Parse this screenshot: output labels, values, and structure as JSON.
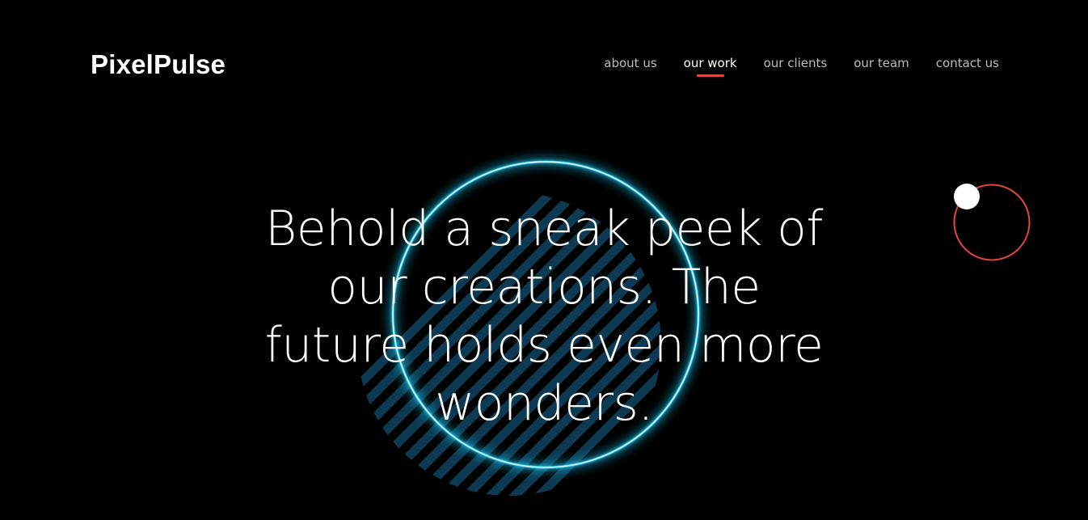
{
  "brand": {
    "name": "PixelPulse"
  },
  "nav": {
    "items": [
      {
        "label": "about us",
        "active": false
      },
      {
        "label": "our work",
        "active": true
      },
      {
        "label": "our clients",
        "active": false
      },
      {
        "label": "our team",
        "active": false
      },
      {
        "label": "contact us",
        "active": false
      }
    ]
  },
  "hero": {
    "headline": "Behold a sneak peek of our creations. The future holds even more wonders."
  },
  "colors": {
    "background": "#000000",
    "text": "#ffffff",
    "nav_text": "#bdbdbd",
    "accent_red": "#e0463c",
    "neon_cyan": "#2fc8f0",
    "stripe": "#0d3a52"
  },
  "icons": {
    "orbit": "orbit-ring-icon",
    "neon": "neon-circle-graphic"
  }
}
